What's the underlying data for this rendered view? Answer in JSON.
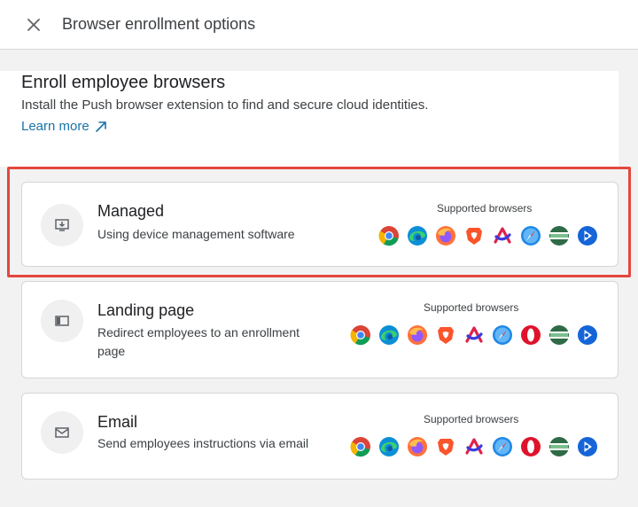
{
  "header": {
    "title": "Browser enrollment options"
  },
  "intro": {
    "title": "Enroll employee browsers",
    "description": "Install the Push browser extension to find and secure cloud identities.",
    "learn_more": "Learn more"
  },
  "supported_label": "Supported browsers",
  "options": [
    {
      "title": "Managed",
      "description": "Using device management software",
      "icon": "device-download-icon",
      "highlighted": true,
      "browsers": [
        "chrome-icon",
        "edge-icon",
        "firefox-icon",
        "brave-icon",
        "arc-icon",
        "safari-icon",
        "island-icon",
        "push-icon"
      ]
    },
    {
      "title": "Landing page",
      "description": "Redirect employees to an enrollment page",
      "icon": "browser-window-icon",
      "browsers": [
        "chrome-icon",
        "edge-icon",
        "firefox-icon",
        "brave-icon",
        "arc-icon",
        "safari-icon",
        "opera-icon",
        "island-icon",
        "push-icon"
      ]
    },
    {
      "title": "Email",
      "description": "Send employees instructions via email",
      "icon": "mail-icon",
      "browsers": [
        "chrome-icon",
        "edge-icon",
        "firefox-icon",
        "brave-icon",
        "arc-icon",
        "safari-icon",
        "opera-icon",
        "island-icon",
        "push-icon"
      ]
    }
  ],
  "colors": {
    "link": "#1a73a8",
    "highlight": "#e4473e"
  }
}
